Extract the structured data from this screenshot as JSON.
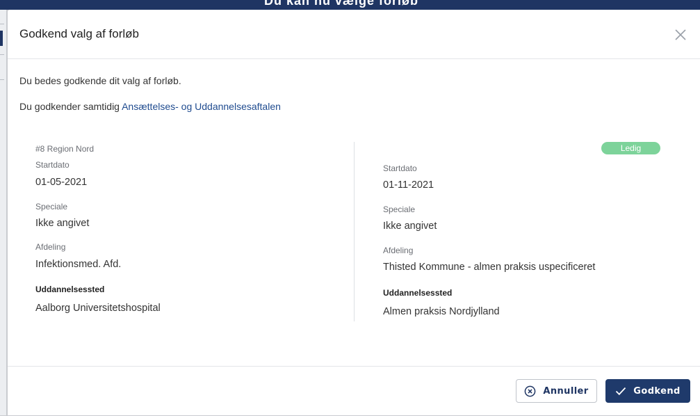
{
  "background": {
    "title": "Du kan nu vælge forløb"
  },
  "dialog": {
    "title": "Godkend valg af forløb",
    "close_icon": "close-icon",
    "intro_line1": "Du bedes godkende dit valg af forløb.",
    "intro_line2_prefix": "Du godkender samtidig ",
    "intro_link": "Ansættelses- og Uddannelsesaftalen"
  },
  "left": {
    "region": "#8 Region Nord",
    "startdato_label": "Startdato",
    "startdato": "01-05-2021",
    "speciale_label": "Speciale",
    "speciale": "Ikke angivet",
    "afdeling_label": "Afdeling",
    "afdeling": "Infektionsmed. Afd.",
    "uddannelsessted_label": "Uddannelsessted",
    "uddannelsessted": "Aalborg Universitetshospital"
  },
  "right": {
    "status_badge": "Ledig",
    "status_color": "#7dd39a",
    "startdato_label": "Startdato",
    "startdato": "01-11-2021",
    "speciale_label": "Speciale",
    "speciale": "Ikke angivet",
    "afdeling_label": "Afdeling",
    "afdeling": "Thisted Kommune - almen praksis uspecificeret",
    "uddannelsessted_label": "Uddannelsessted",
    "uddannelsessted": "Almen praksis Nordjylland"
  },
  "footer": {
    "cancel_label": "Annuller",
    "cancel_icon": "x-circle-icon",
    "approve_label": "Godkend",
    "approve_icon": "check-icon",
    "primary_color": "#1f3a6b"
  }
}
